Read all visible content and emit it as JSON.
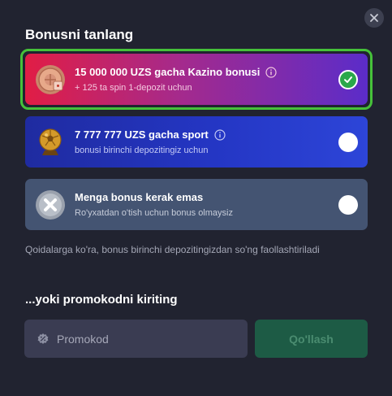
{
  "modal": {
    "title": "Bonusni tanlang"
  },
  "bonuses": [
    {
      "name": "15 000 000 UZS gacha Kazino bonusi",
      "description": "+ 125 ta spin 1-depozit uchun",
      "selected": true,
      "icon": "casino-chip-icon"
    },
    {
      "name": "7 777 777 UZS gacha sport",
      "description": "bonusi birinchi depozitingiz uchun",
      "selected": false,
      "icon": "football-trophy-icon"
    },
    {
      "name": "Menga bonus kerak emas",
      "description": "Ro'yxatdan o'tish uchun bonus olmaysiz",
      "selected": false,
      "icon": "no-bonus-icon"
    }
  ],
  "rules_text": "Qoidalarga ko'ra, bonus birinchi depozitingizdan so'ng faollashtiriladi",
  "promo": {
    "title": "...yoki promokodni kiriting",
    "placeholder": "Promokod",
    "value": "",
    "apply_label": "Qo'llash"
  },
  "colors": {
    "background": "#212330",
    "selected_border": "#46c13a",
    "apply_button": "#1d5b45"
  }
}
